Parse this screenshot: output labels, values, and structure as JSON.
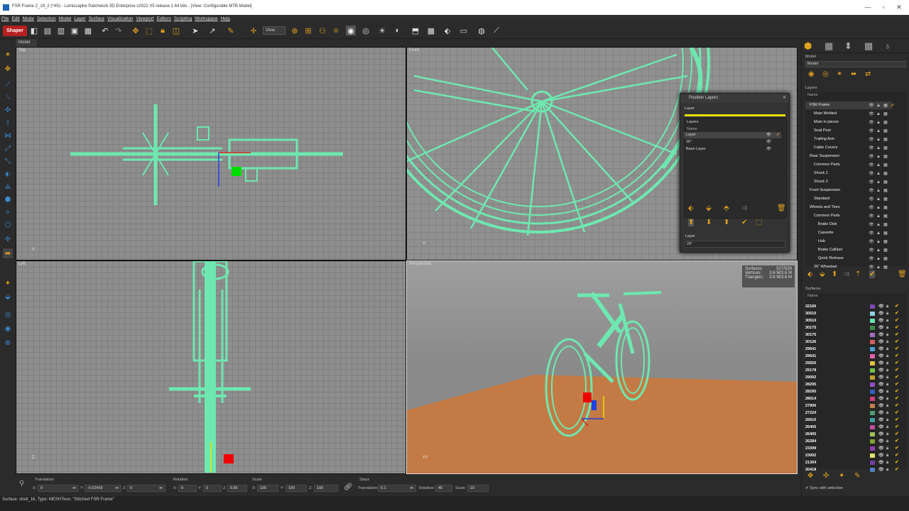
{
  "window": {
    "title": "FSR Frame 2_19_2  (*4S) - Lumiscaphe Patchwork 3D Enterprise v2022 X5 release 1 64 bits - [View: Configurable MTB Model]",
    "minimize": "—",
    "maximize": "▫",
    "close": "✕"
  },
  "menu": [
    "File",
    "Edit",
    "Mode",
    "Selection",
    "Model",
    "Layer",
    "Surface",
    "Visualization",
    "Viewport",
    "Editors",
    "Scripting",
    "Workspace",
    "Help"
  ],
  "toolbar": {
    "mode_label": "Shaper",
    "view_select": "View"
  },
  "model_tab": "Model",
  "viewports": {
    "top": "Top",
    "front": "Front",
    "left": "Left",
    "perspective": "Perspective"
  },
  "stats": {
    "surfaces_label": "Surfaces:",
    "surfaces": "527/528",
    "vertices_label": "Vertices:",
    "vertices": "3.6 M/3.6 M",
    "triangles_label": "Triangles:",
    "triangles": "3.6 M/3.6 M"
  },
  "position_layers": {
    "title": "Position Layers",
    "layer_label": "Layer",
    "layers_label": "Layers",
    "name_header": "Name",
    "rows": [
      "Layer",
      "26\"",
      "Base Layer"
    ],
    "bottom_label": "Layer",
    "bottom_value": "29\""
  },
  "right_panel": {
    "model_label": "Model",
    "model_select": "Model",
    "layers_label": "Layers",
    "name_header": "Name",
    "layers": [
      "FSR Frame",
      "Main Welded",
      "Main in pieces",
      "Seat Post",
      "Trailing Arm",
      "Cable Covers",
      "Rear Suspension",
      "Common Parts",
      "Shock 1",
      "Shock 2",
      "Front Suspension",
      "Standard",
      "Wheels and Tires",
      "Common Parts",
      "Brake Disk",
      "Cassette",
      "Hub",
      "Brake Calliper",
      "Quick Release",
      "26\" Wheelset"
    ],
    "surfaces_label": "Surfaces",
    "surfaces_name_header": "Name",
    "surfaces": [
      {
        "n": "32160",
        "c": "#7a4ab0"
      },
      {
        "n": "30510",
        "c": "#8fd0e0"
      },
      {
        "n": "30510",
        "c": "#6be0b0"
      },
      {
        "n": "30175",
        "c": "#3a8a4a"
      },
      {
        "n": "30175",
        "c": "#a070c0"
      },
      {
        "n": "30126",
        "c": "#d06060"
      },
      {
        "n": "29641",
        "c": "#4aa0d0"
      },
      {
        "n": "29641",
        "c": "#e060b0"
      },
      {
        "n": "29550",
        "c": "#e0c040"
      },
      {
        "n": "29178",
        "c": "#70c050"
      },
      {
        "n": "29092",
        "c": "#c0a030"
      },
      {
        "n": "28295",
        "c": "#9050c0"
      },
      {
        "n": "28295",
        "c": "#3060c0"
      },
      {
        "n": "28014",
        "c": "#d04080"
      },
      {
        "n": "27906",
        "c": "#c08050"
      },
      {
        "n": "27224",
        "c": "#50a070"
      },
      {
        "n": "26610",
        "c": "#40a0a0"
      },
      {
        "n": "26405",
        "c": "#c050a0"
      },
      {
        "n": "26405",
        "c": "#a0c060"
      },
      {
        "n": "26284",
        "c": "#80a030"
      },
      {
        "n": "23399",
        "c": "#9040b0"
      },
      {
        "n": "23002",
        "c": "#e0e070"
      },
      {
        "n": "21304",
        "c": "#7040a0"
      },
      {
        "n": "20418",
        "c": "#5080c0"
      }
    ],
    "sync_label": "Sync with selection"
  },
  "bottom": {
    "translation_label": "Translation",
    "rotation_label": "Rotation",
    "scale_label": "Scale",
    "steps_label": "Steps",
    "tx": "0",
    "ty": "-0.02459",
    "tz": "0",
    "unit": "m",
    "rx": "0",
    "ry": "0",
    "rz": "0.56",
    "sx": "100",
    "sy": "100",
    "sz": "100",
    "step_translation_label": "Translation:",
    "step_translation": "0.1",
    "step_rotation_label": "Rotation:",
    "step_rotation": "45",
    "step_scale_label": "Scale:",
    "step_scale": "10"
  },
  "status": "Surface: shell_16, Type: MESHTexo: \"Stitched FSR Frame\""
}
